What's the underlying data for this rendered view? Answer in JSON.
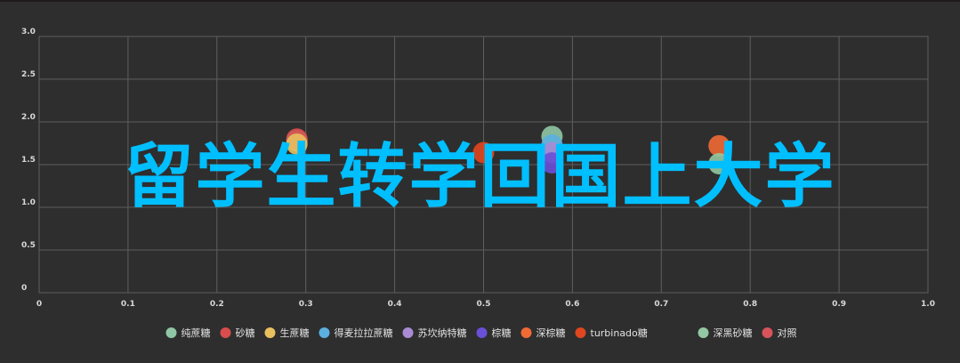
{
  "chart_data": {
    "type": "scatter",
    "xlim": [
      0,
      1.0
    ],
    "ylim": [
      0,
      3.0
    ],
    "xticks": [
      "0",
      "0.1",
      "0.2",
      "0.3",
      "0.4",
      "0.5",
      "0.6",
      "0.7",
      "0.8",
      "0.9",
      "1.0"
    ],
    "yticks": [
      "0",
      "0.5",
      "1.0",
      "1.5",
      "2.0",
      "2.5",
      "3.0"
    ],
    "grid": true,
    "legend_position": "bottom",
    "series": [
      {
        "name": "纯蔗糖",
        "color": "#8fc7a4",
        "points": [
          [
            0.29,
            1.78
          ],
          [
            0.577,
            1.83
          ]
        ]
      },
      {
        "name": "砂糖",
        "color": "#d94d4d",
        "points": [
          [
            0.29,
            1.8
          ]
        ]
      },
      {
        "name": "生蔗糖",
        "color": "#e8c05e",
        "points": [
          [
            0.29,
            1.74
          ]
        ]
      },
      {
        "name": "得麦拉拉蔗糖",
        "color": "#5bb0e0",
        "points": [
          [
            0.577,
            1.73
          ]
        ]
      },
      {
        "name": "苏坎纳特糖",
        "color": "#a98bd4",
        "points": [
          [
            0.577,
            1.64
          ]
        ]
      },
      {
        "name": "棕糖",
        "color": "#6a4fd8",
        "points": [
          [
            0.577,
            1.52
          ]
        ]
      },
      {
        "name": "深棕糖",
        "color": "#f06a35",
        "points": [
          [
            0.765,
            1.72
          ]
        ]
      },
      {
        "name": "turbinado糖",
        "color": "#e0461f",
        "points": [
          [
            0.5,
            1.64
          ]
        ]
      },
      {
        "name": "深黑砂糖",
        "color": "#93c8a2",
        "points": [
          [
            0.765,
            1.51
          ]
        ]
      },
      {
        "name": "对照",
        "color": "#d9535a",
        "points": []
      }
    ]
  },
  "overlay_text": "留学生转学回国上大学"
}
